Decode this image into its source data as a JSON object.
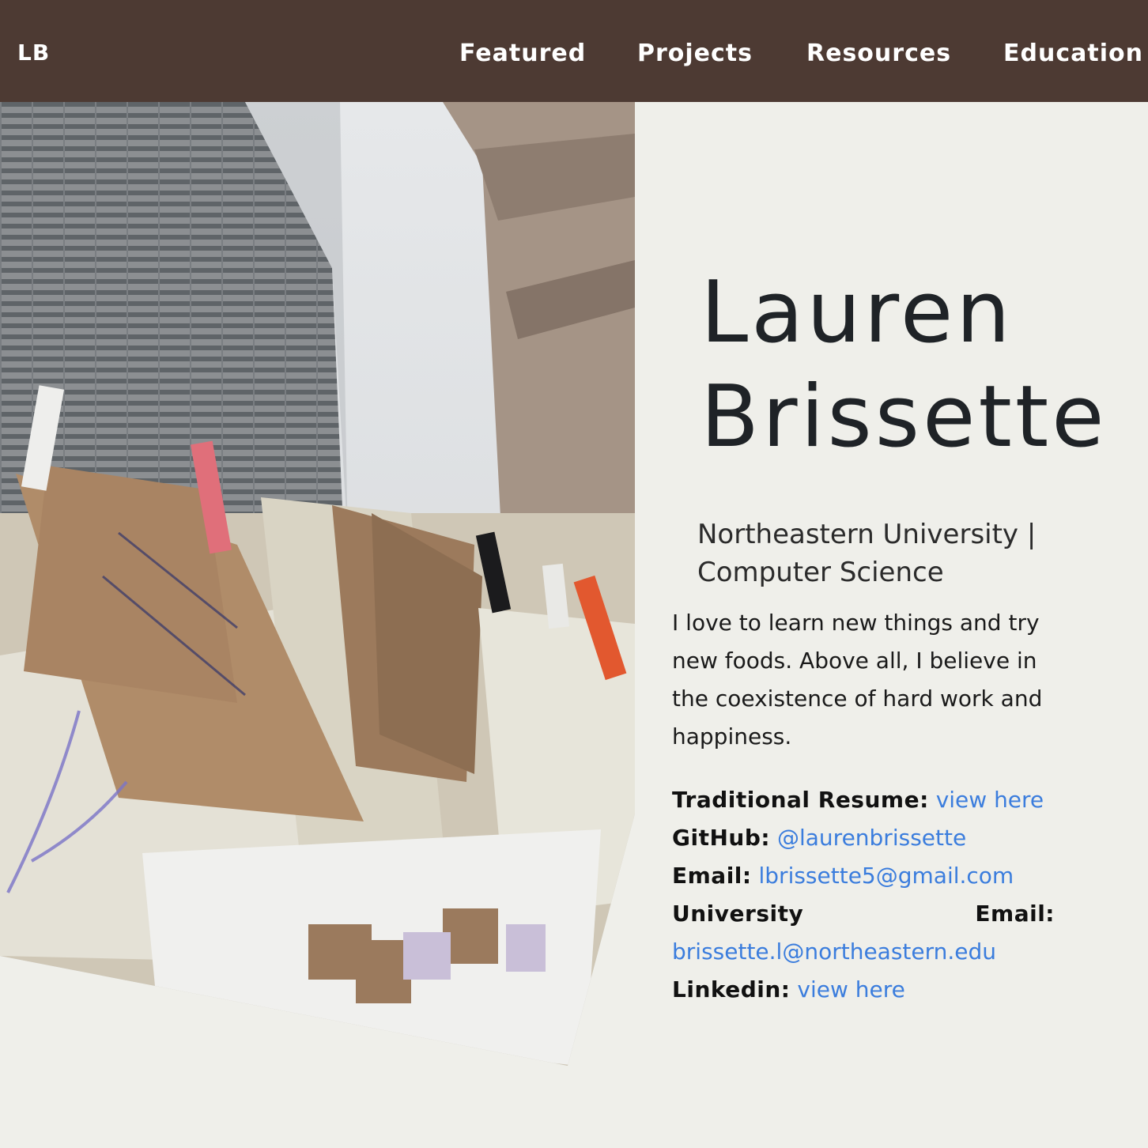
{
  "navbar": {
    "brand": "LB",
    "links": [
      "Featured",
      "Projects",
      "Resources",
      "Education"
    ]
  },
  "hero": {
    "photo_icon": "clothesline-notes-photo",
    "name_first": "Lauren",
    "name_last": "Brissette",
    "subtitle": "Northeastern University | Computer Science",
    "bio": "I love to learn new things and try new foods. Above all, I believe in the coexistence of hard work and happiness."
  },
  "contacts": {
    "resume_label": "Traditional Resume:",
    "resume_link": "view here",
    "github_label": "GitHub:",
    "github_link": "@laurenbrissette",
    "email_label": "Email:",
    "email_link": "lbrissette5@gmail.com",
    "uni_email_label_1": "University",
    "uni_email_label_2": "Email:",
    "uni_email_link": "brissette.l@northeastern.edu",
    "linkedin_label": "Linkedin:",
    "linkedin_link": "view here"
  },
  "colors": {
    "navbar": "#4d3a33",
    "background": "#efefea",
    "link": "#3b7ddd",
    "heading": "#1f2327"
  }
}
